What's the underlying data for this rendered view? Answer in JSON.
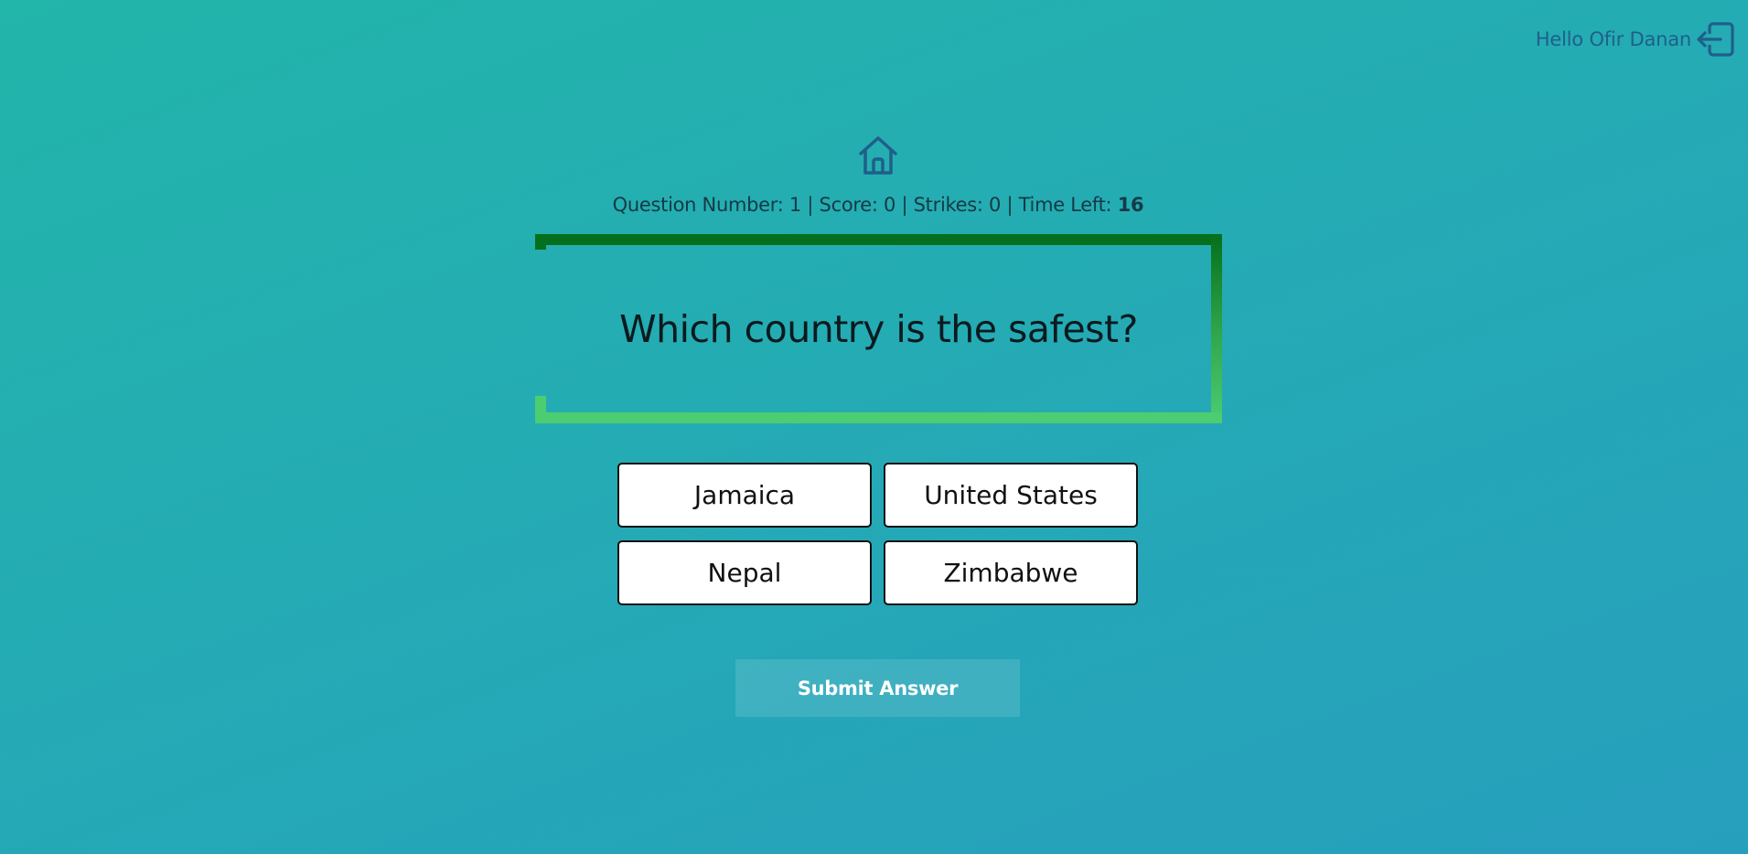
{
  "header": {
    "greeting": "Hello Ofir Danan",
    "logout_icon": "logout-icon"
  },
  "nav": {
    "home_icon": "home-icon"
  },
  "stats": {
    "question_label": "Question Number:",
    "question_number": "1",
    "score_label": "Score:",
    "score": "0",
    "strikes_label": "Strikes:",
    "strikes": "0",
    "time_label": "Time Left:",
    "time_left": "16",
    "separator": "|"
  },
  "question": {
    "text": "Which country is the safest?"
  },
  "answers": [
    {
      "label": "Jamaica"
    },
    {
      "label": "United States"
    },
    {
      "label": "Nepal"
    },
    {
      "label": "Zimbabwe"
    }
  ],
  "submit": {
    "label": "Submit Answer"
  },
  "colors": {
    "frame_dark": "#046f1c",
    "frame_light": "#4ccd72",
    "icon": "#1f5f8a"
  }
}
